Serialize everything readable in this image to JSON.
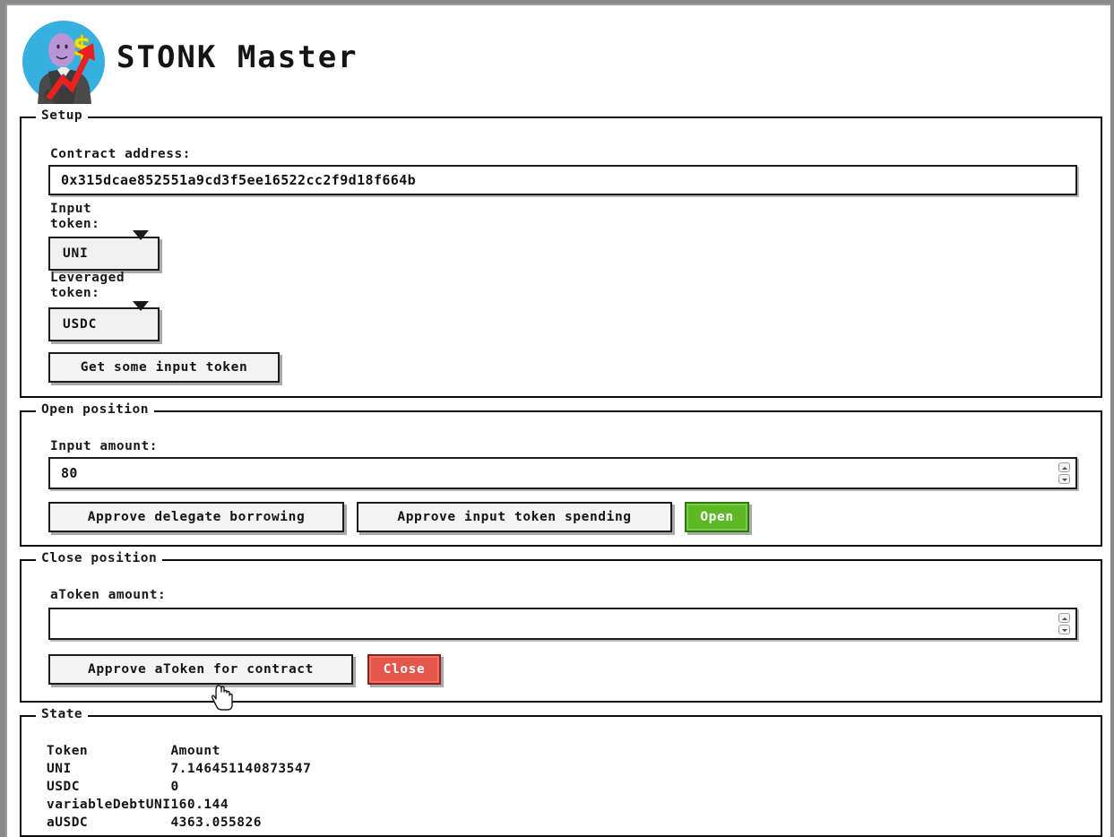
{
  "app": {
    "title": "STONK Master",
    "logo_icon": "stonks-meme-icon"
  },
  "setup": {
    "group_title": "Setup",
    "contract_address_label": "Contract address:",
    "contract_address_value": "0x315dcae852551a9cd3f5ee16522cc2f9d18f664b",
    "input_token_label": "Input\ntoken:",
    "input_token_value": "UNI",
    "leveraged_token_label": "Leveraged\ntoken:",
    "leveraged_token_value": "USDC",
    "get_token_button": "Get some input token"
  },
  "open_position": {
    "group_title": "Open position",
    "input_amount_label": "Input amount:",
    "input_amount_value": "80",
    "approve_delegate_button": "Approve delegate borrowing",
    "approve_spending_button": "Approve input token spending",
    "open_button": "Open"
  },
  "close_position": {
    "group_title": "Close position",
    "atoken_amount_label": "aToken amount:",
    "atoken_amount_value": "",
    "approve_atoken_button": "Approve aToken for contract",
    "close_button": "Close"
  },
  "state": {
    "group_title": "State",
    "columns": [
      "Token",
      "Amount"
    ],
    "rows": [
      {
        "token": "UNI",
        "amount": "7.146451140873547"
      },
      {
        "token": "USDC",
        "amount": "0"
      },
      {
        "token": "variableDebtUNI",
        "amount": "160.144"
      },
      {
        "token": "aUSDC",
        "amount": "4363.055826"
      }
    ]
  },
  "colors": {
    "open_green": "#5db826",
    "close_red": "#e4574a",
    "logo_circle_blue": "#37b0e0",
    "logo_arrow_red": "#e8201f",
    "logo_dollar_yellow": "#efe21c",
    "window_frame_gray": "#8a8a8a"
  },
  "cursor": {
    "icon": "pointing-hand-cursor"
  }
}
